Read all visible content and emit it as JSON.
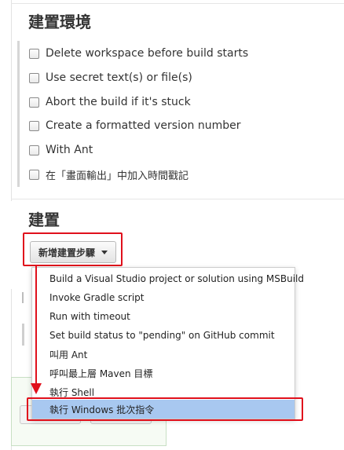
{
  "build_environment": {
    "title": "建置環境",
    "options": [
      {
        "label": "Delete workspace before build starts",
        "checked": false
      },
      {
        "label": "Use secret text(s) or file(s)",
        "checked": false
      },
      {
        "label": "Abort the build if it's stuck",
        "checked": false
      },
      {
        "label": "Create a formatted version number",
        "checked": false
      },
      {
        "label": "With Ant",
        "checked": false
      },
      {
        "label": "在「畫面輸出」中加入時間戳記",
        "checked": false
      }
    ]
  },
  "build": {
    "title": "建置",
    "add_step_button": "新增建置步驟",
    "dropdown": {
      "items": [
        {
          "label": "Build a Visual Studio project or solution using MSBuild",
          "highlighted": false
        },
        {
          "label": "Invoke Gradle script",
          "highlighted": false
        },
        {
          "label": "Run with timeout",
          "highlighted": false
        },
        {
          "label": "Set build status to \"pending\" on GitHub commit",
          "highlighted": false
        },
        {
          "label": "叫用 Ant",
          "highlighted": false
        },
        {
          "label": "呼叫最上層 Maven 目標",
          "highlighted": false
        },
        {
          "label": "執行 Shell",
          "highlighted": false
        },
        {
          "label": "執行 Windows 批次指令",
          "highlighted": true
        }
      ]
    }
  },
  "annotation": {
    "color": "#e0101c",
    "highlight_color": "#a8c8f0"
  }
}
